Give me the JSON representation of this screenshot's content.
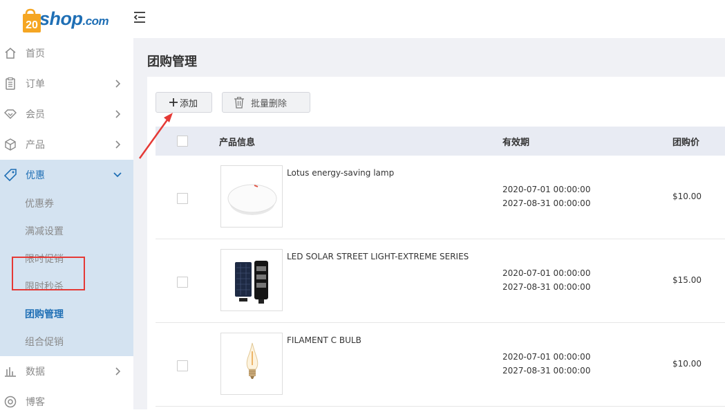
{
  "brand": {
    "logo_prefix": "20",
    "logo_text": "shop",
    "logo_domain": ".com",
    "accent": "#1f6fb5",
    "badge_color": "#f5a623"
  },
  "sidebar": {
    "items": [
      {
        "label": "首页",
        "icon": "home-icon"
      },
      {
        "label": "订单",
        "icon": "order-icon"
      },
      {
        "label": "会员",
        "icon": "member-icon"
      },
      {
        "label": "产品",
        "icon": "product-box-icon"
      },
      {
        "label": "优惠",
        "icon": "discount-tag-icon"
      },
      {
        "label": "数据",
        "icon": "bar-chart-icon"
      },
      {
        "label": "博客",
        "icon": "blog-icon"
      }
    ],
    "promo_sub": [
      "优惠券",
      "满减设置",
      "限时促销",
      "限时秒杀",
      "团购管理",
      "组合促销"
    ]
  },
  "page": {
    "title": "团购管理"
  },
  "toolbar": {
    "add_label": "添加",
    "batch_delete_label": "批量删除"
  },
  "table": {
    "headers": {
      "product": "产品信息",
      "period": "有效期",
      "price": "团购价"
    },
    "rows": [
      {
        "name": "Lotus energy-saving lamp",
        "start": "2020-07-01 00:00:00",
        "end": "2027-08-31 00:00:00",
        "price": "$10.00",
        "thumb": "round-lamp"
      },
      {
        "name": "LED SOLAR STREET LIGHT-EXTREME SERIES",
        "start": "2020-07-01 00:00:00",
        "end": "2027-08-31 00:00:00",
        "price": "$15.00",
        "thumb": "solar-light"
      },
      {
        "name": "FILAMENT C BULB",
        "start": "2020-07-01 00:00:00",
        "end": "2027-08-31 00:00:00",
        "price": "$10.00",
        "thumb": "filament-bulb"
      }
    ]
  }
}
